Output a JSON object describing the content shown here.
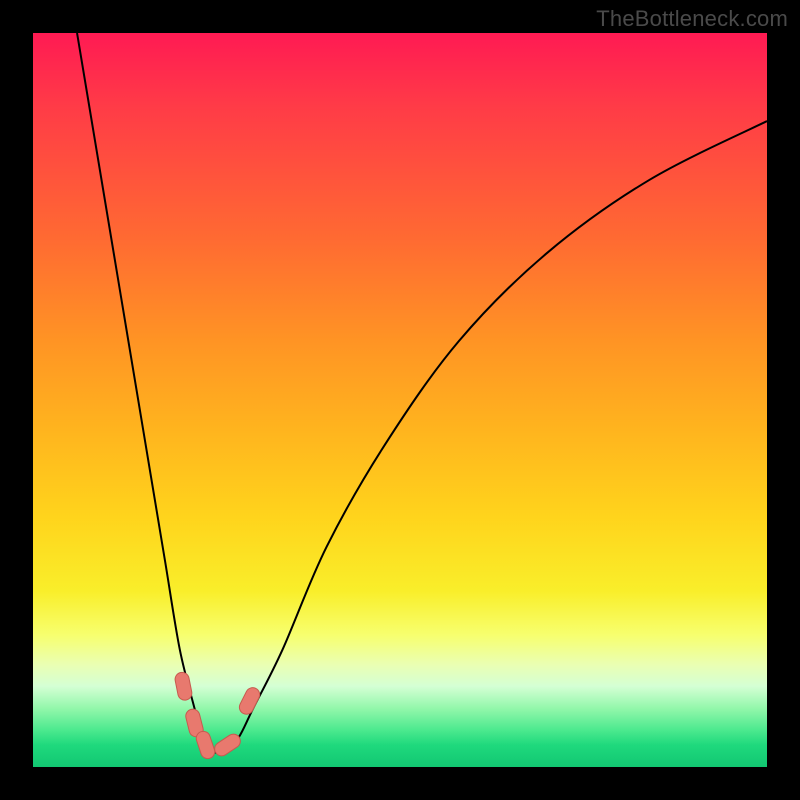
{
  "watermark": {
    "text": "TheBottleneck.com"
  },
  "chart_data": {
    "type": "line",
    "title": "",
    "xlabel": "",
    "ylabel": "",
    "xlim": [
      0,
      100
    ],
    "ylim": [
      0,
      100
    ],
    "grid": false,
    "series": [
      {
        "name": "bottleneck-curve",
        "x": [
          6,
          8,
          10,
          12,
          14,
          16,
          18,
          20,
          22,
          23,
          24,
          25,
          26,
          28,
          30,
          34,
          40,
          48,
          58,
          70,
          84,
          100
        ],
        "y": [
          100,
          88,
          76,
          64,
          52,
          40,
          28,
          16,
          8,
          4,
          2,
          2,
          2,
          4,
          8,
          16,
          30,
          44,
          58,
          70,
          80,
          88
        ]
      }
    ],
    "markers": [
      {
        "name": "marker-left-descend-1",
        "x": 20.5,
        "y": 11
      },
      {
        "name": "marker-left-descend-2",
        "x": 22.0,
        "y": 6
      },
      {
        "name": "marker-bottom-left",
        "x": 23.5,
        "y": 3
      },
      {
        "name": "marker-bottom-right",
        "x": 26.5,
        "y": 3
      },
      {
        "name": "marker-right-ascend",
        "x": 29.5,
        "y": 9
      }
    ],
    "marker_style": {
      "fill": "#e8796e",
      "stroke": "#c75a4f"
    },
    "curve_style": {
      "stroke": "#000000",
      "width": 2
    }
  }
}
